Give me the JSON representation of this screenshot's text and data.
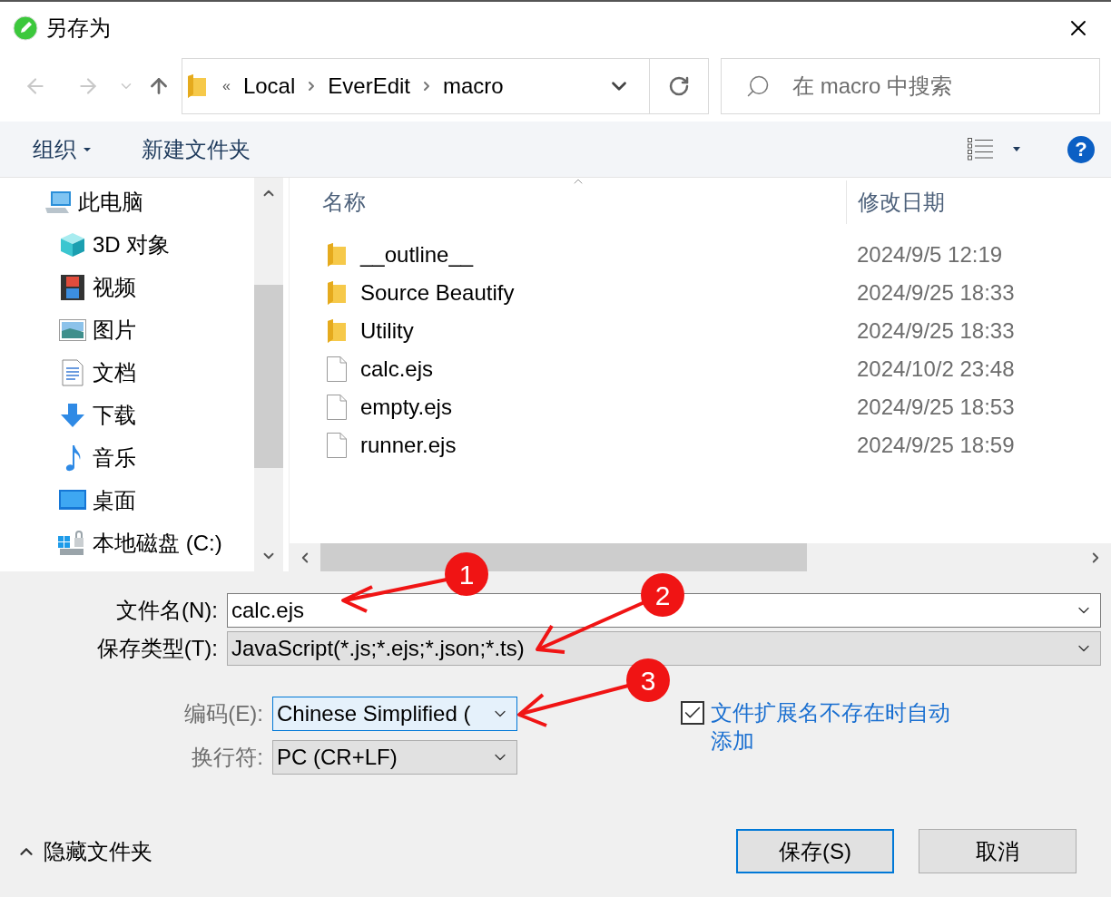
{
  "window": {
    "title": "另存为"
  },
  "address": {
    "overflow": "«",
    "crumbs": [
      "Local",
      "EverEdit",
      "macro"
    ]
  },
  "search": {
    "placeholder": "在 macro 中搜索"
  },
  "toolbar": {
    "organize": "组织",
    "new_folder": "新建文件夹",
    "help": "?"
  },
  "sidebar": {
    "items": [
      {
        "label": "此电脑",
        "children": [
          {
            "label": "3D 对象"
          },
          {
            "label": "视频"
          },
          {
            "label": "图片"
          },
          {
            "label": "文档"
          },
          {
            "label": "下载"
          },
          {
            "label": "音乐"
          },
          {
            "label": "桌面"
          },
          {
            "label": "本地磁盘 (C:)"
          }
        ]
      }
    ]
  },
  "file_list": {
    "columns": [
      "名称",
      "修改日期"
    ],
    "rows": [
      {
        "name": "__outline__",
        "kind": "folder",
        "modified": "2024/9/5 12:19"
      },
      {
        "name": "Source Beautify",
        "kind": "folder",
        "modified": "2024/9/25 18:33"
      },
      {
        "name": "Utility",
        "kind": "folder",
        "modified": "2024/9/25 18:33"
      },
      {
        "name": "calc.ejs",
        "kind": "file",
        "modified": "2024/10/2 23:48"
      },
      {
        "name": "empty.ejs",
        "kind": "file",
        "modified": "2024/9/25 18:53"
      },
      {
        "name": "runner.ejs",
        "kind": "file",
        "modified": "2024/9/25 18:59"
      }
    ]
  },
  "form": {
    "file_name": {
      "label": "文件名(N):",
      "value": "calc.ejs"
    },
    "save_type": {
      "label": "保存类型(T):",
      "value": "JavaScript(*.js;*.ejs;*.json;*.ts)"
    },
    "encoding": {
      "label": "编码(E):",
      "value": "Chinese Simplified (",
      "focused": true
    },
    "line_ending": {
      "label": "换行符:",
      "value": "PC (CR+LF)",
      "focused": false
    },
    "auto_extension": {
      "label": "文件扩展名不存在时自动添加",
      "checked": true
    }
  },
  "hide_folders": "隐藏文件夹",
  "buttons": [
    {
      "label": "保存(S)",
      "default": true
    },
    {
      "label": "取消",
      "default": false
    }
  ],
  "annotations": [
    {
      "number": "1"
    },
    {
      "number": "2"
    },
    {
      "number": "3"
    }
  ]
}
